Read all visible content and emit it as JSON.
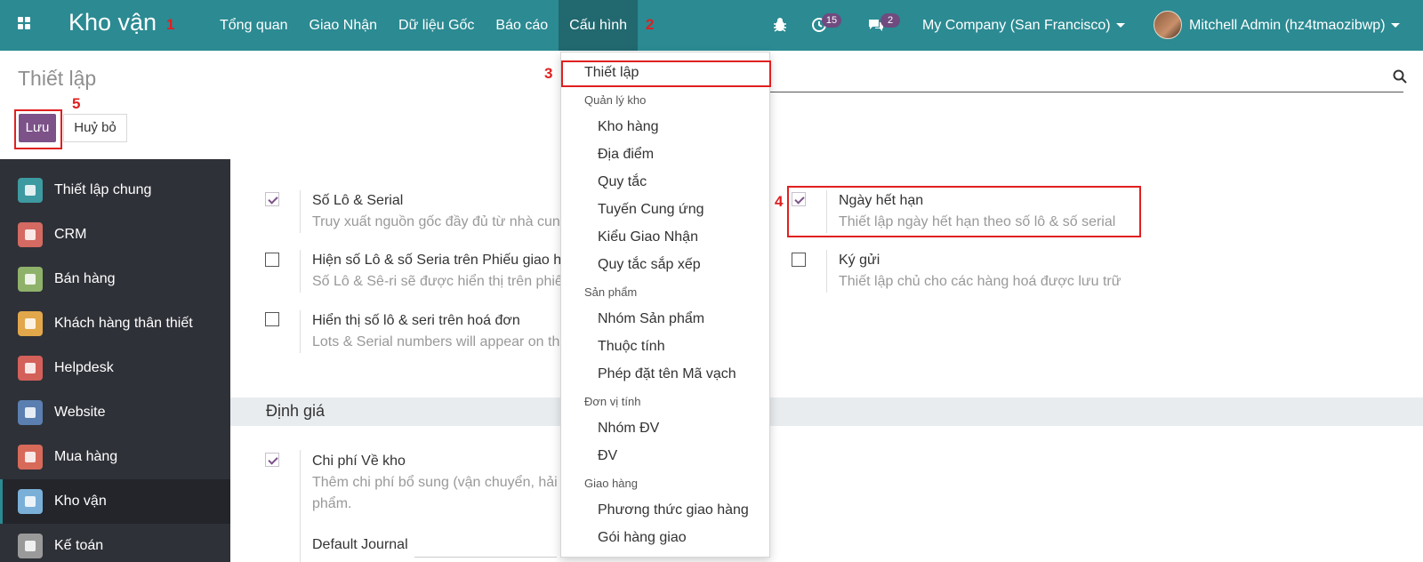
{
  "navbar": {
    "brand": "Kho vận",
    "menu": [
      "Tổng quan",
      "Giao Nhận",
      "Dữ liệu Gốc",
      "Báo cáo",
      "Cấu hình"
    ],
    "activity_count": "15",
    "message_count": "2",
    "company": "My Company (San Francisco)",
    "user": "Mitchell Admin (hz4tmaozibwp)"
  },
  "control_panel": {
    "title": "Thiết lập",
    "save_label": "Lưu",
    "discard_label": "Huỷ bỏ"
  },
  "annotations": [
    "1",
    "2",
    "3",
    "4",
    "5"
  ],
  "dropdown": {
    "top_item": "Thiết lập",
    "groups": [
      {
        "header": "Quản lý kho",
        "items": [
          "Kho hàng",
          "Địa điểm",
          "Quy tắc",
          "Tuyến Cung ứng",
          "Kiểu Giao Nhận",
          "Quy tắc sắp xếp"
        ]
      },
      {
        "header": "Sản phẩm",
        "items": [
          "Nhóm Sản phẩm",
          "Thuộc tính",
          "Phép đặt tên Mã vạch"
        ]
      },
      {
        "header": "Đơn vị tính",
        "items": [
          "Nhóm ĐV",
          "ĐV"
        ]
      },
      {
        "header": "Giao hàng",
        "items": [
          "Phương thức giao hàng",
          "Gói hàng giao"
        ]
      }
    ]
  },
  "sidebar": {
    "items": [
      {
        "label": "Thiết lập chung",
        "icon": "gear-icon",
        "color": "#3d9aa0"
      },
      {
        "label": "CRM",
        "icon": "handshake-icon",
        "color": "#d46a62"
      },
      {
        "label": "Bán hàng",
        "icon": "chart-icon",
        "color": "#8fb26a"
      },
      {
        "label": "Khách hàng thân thiết",
        "icon": "loyalty-icon",
        "color": "#e2a74a"
      },
      {
        "label": "Helpdesk",
        "icon": "helpdesk-icon",
        "color": "#d4605a"
      },
      {
        "label": "Website",
        "icon": "globe-icon",
        "color": "#5a7fb0"
      },
      {
        "label": "Mua hàng",
        "icon": "credit-card-icon",
        "color": "#d86a5a"
      },
      {
        "label": "Kho vận",
        "icon": "box-icon",
        "color": "#7ab0d8"
      },
      {
        "label": "Kế toán",
        "icon": "accounting-icon",
        "color": "#9a9a9a"
      }
    ],
    "active": "Kho vận"
  },
  "settings": {
    "lots_serial": {
      "title": "Số Lô & Serial",
      "desc": "Truy xuất nguồn gốc đầy đủ từ nhà cun",
      "checked": true
    },
    "expiry": {
      "title": "Ngày hết hạn",
      "desc": "Thiết lập ngày hết hạn theo số lô & số serial",
      "checked": true
    },
    "show_lots_picking": {
      "title": "Hiện số Lô & số Seria trên Phiếu giao h",
      "desc": "Số Lô & Sê-ri sẽ được hiển thị trên phiếu",
      "checked": false
    },
    "consignment": {
      "title": "Ký gửi",
      "desc": "Thiết lập chủ cho các hàng hoá được lưu trữ",
      "checked": false
    },
    "lots_invoice": {
      "title": "Hiển thị số lô & seri trên hoá đơn",
      "desc": "Lots & Serial numbers will appear on th",
      "checked": false
    },
    "valuation_header": "Định giá",
    "landed_costs": {
      "title": "Chi phí Về kho",
      "desc1": "Thêm chi phí bổ sung (vận chuyển, hải",
      "desc2": "phẩm.",
      "checked": true
    },
    "default_journal": "Default Journal"
  }
}
